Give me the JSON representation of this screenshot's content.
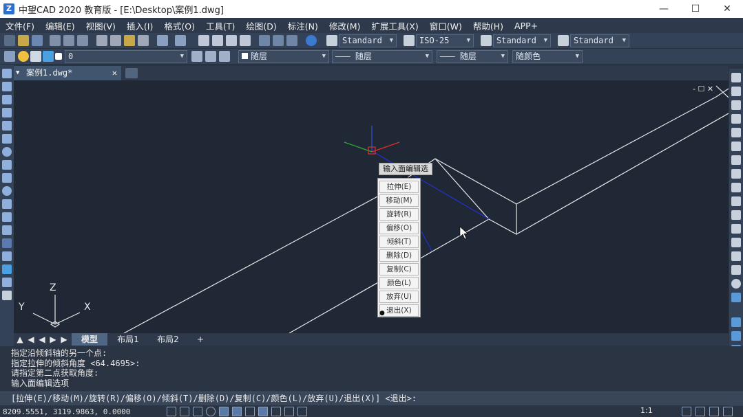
{
  "window": {
    "title": "中望CAD 2020 教育版 - [E:\\Desktop\\案例1.dwg]",
    "logo_text": "Z",
    "minimize": "—",
    "maximize": "☐",
    "close": "✕"
  },
  "menu": [
    "文件(F)",
    "编辑(E)",
    "视图(V)",
    "插入(I)",
    "格式(O)",
    "工具(T)",
    "绘图(D)",
    "标注(N)",
    "修改(M)",
    "扩展工具(X)",
    "窗口(W)",
    "帮助(H)",
    "APP+"
  ],
  "toolbar1": {
    "text_style": "Standard",
    "dim_style": "ISO-25",
    "table_style": "Standard",
    "mleader_style": "Standard"
  },
  "toolbar2": {
    "layer": "0",
    "color": "随层",
    "linetype": "——— 随层",
    "lineweight": "——— 随层",
    "plotstyle": "随颜色"
  },
  "doc_tab": {
    "label": "案例1.dwg*",
    "close": "✕"
  },
  "canvas": {
    "viewport_controls": "- ☐ ✕",
    "ucs": {
      "x_label": "X",
      "y_label": "Y",
      "z_label": "Z"
    }
  },
  "tooltip": "输入面编辑选项",
  "context_menu": [
    {
      "label": "拉伸(E)"
    },
    {
      "label": "移动(M)"
    },
    {
      "label": "旋转(R)"
    },
    {
      "label": "偏移(O)"
    },
    {
      "label": "倾斜(T)"
    },
    {
      "label": "删除(D)"
    },
    {
      "label": "复制(C)"
    },
    {
      "label": "颜色(L)"
    },
    {
      "label": "放弃(U)"
    },
    {
      "label": "退出(X)",
      "selected": true
    }
  ],
  "context_menu_bullet": "●",
  "layout_tabs": {
    "model": "模型",
    "layout1": "布局1",
    "layout2": "布局2",
    "add": "+"
  },
  "command_history": [
    "指定沿倾斜轴的另一个点:",
    "指定拉伸的倾斜角度 <64.4695>:",
    "请指定第二点获取角度:",
    "输入面编辑选项"
  ],
  "command_prompt": "[拉伸(E)/移动(M)/旋转(R)/偏移(O)/倾斜(T)/删除(D)/复制(C)/颜色(L)/放弃(U)/退出(X)] <退出>:",
  "status": {
    "coordinates": "8209.5551, 3119.9863, 0.0000",
    "scale": "1:1"
  },
  "colors": {
    "canvas_bg": "#212835",
    "ui_bg": "#344257",
    "wireframe": "#e8e8e8",
    "axis_x": "#e03030",
    "axis_y": "#30b030",
    "axis_z": "#3050e0"
  }
}
